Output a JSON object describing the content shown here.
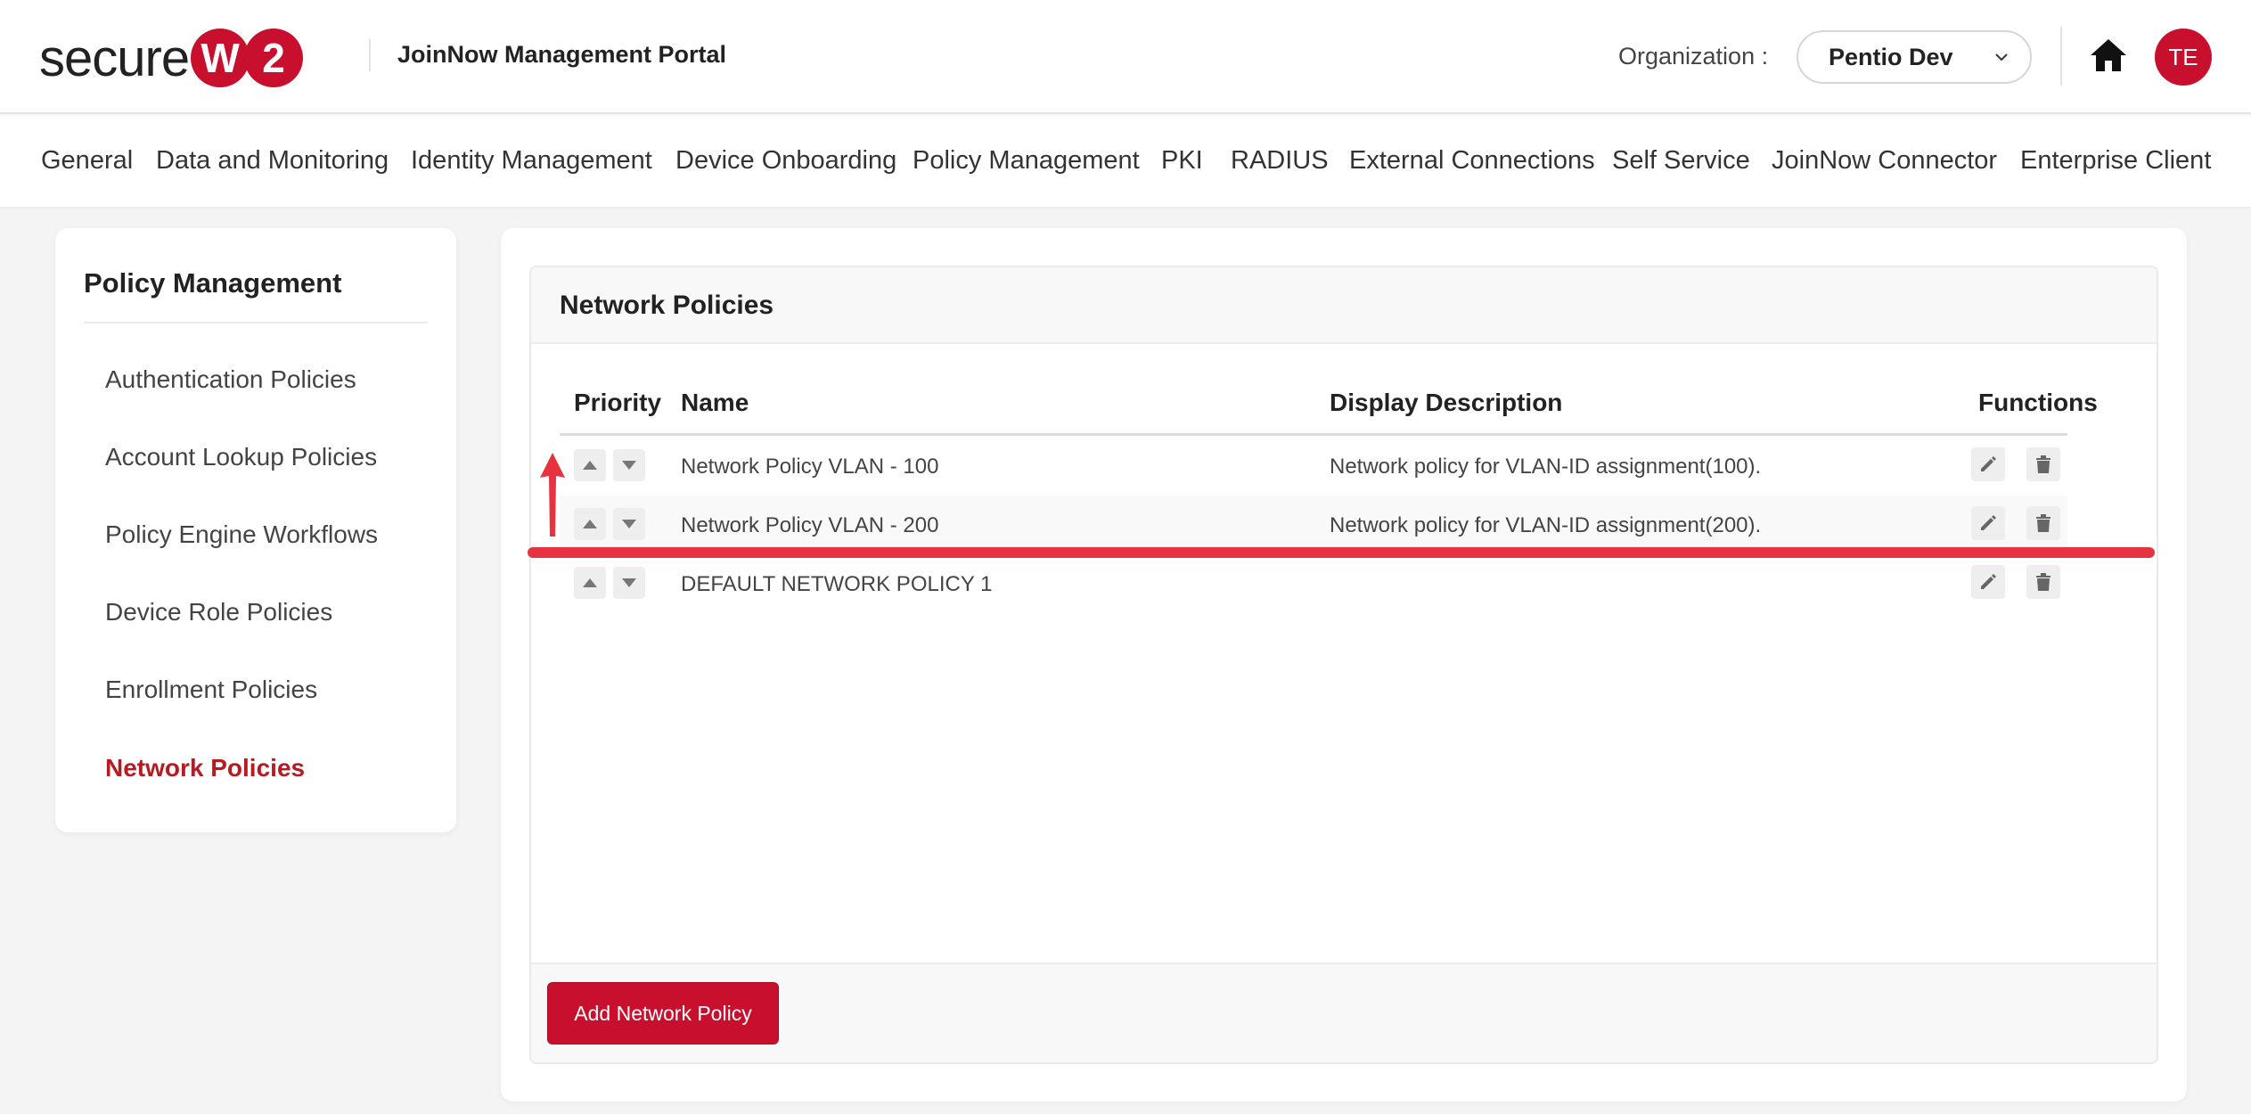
{
  "header": {
    "logo_text": "secure",
    "logo_badge": [
      "W",
      "2"
    ],
    "portal_title": "JoinNow Management Portal",
    "org_label": "Organization :",
    "org_value": "Pentio Dev",
    "home_icon": "home-icon",
    "avatar_initials": "TE"
  },
  "nav": {
    "items": [
      "General",
      "Data and Monitoring",
      "Identity Management",
      "Device Onboarding",
      "Policy Management",
      "PKI",
      "RADIUS",
      "External Connections",
      "Self Service",
      "JoinNow Connector",
      "Enterprise Client"
    ]
  },
  "sidebar": {
    "title": "Policy Management",
    "items": [
      {
        "label": "Authentication Policies",
        "active": false
      },
      {
        "label": "Account Lookup Policies",
        "active": false
      },
      {
        "label": "Policy Engine Workflows",
        "active": false
      },
      {
        "label": "Device Role Policies",
        "active": false
      },
      {
        "label": "Enrollment Policies",
        "active": false
      },
      {
        "label": "Network Policies",
        "active": true
      }
    ]
  },
  "panel": {
    "title": "Network Policies",
    "columns": [
      "Priority",
      "Name",
      "Display Description",
      "Functions"
    ],
    "rows": [
      {
        "name": "Network Policy VLAN - 100",
        "description": "Network policy for VLAN-ID assignment(100)."
      },
      {
        "name": "Network Policy VLAN - 200",
        "description": "Network policy for VLAN-ID assignment(200)."
      },
      {
        "name": "DEFAULT NETWORK POLICY 1",
        "description": ""
      }
    ],
    "add_button": "Add Network Policy"
  },
  "colors": {
    "brand_red": "#c8102e",
    "active_text": "#b71b22",
    "annotation": "#e6333f"
  }
}
